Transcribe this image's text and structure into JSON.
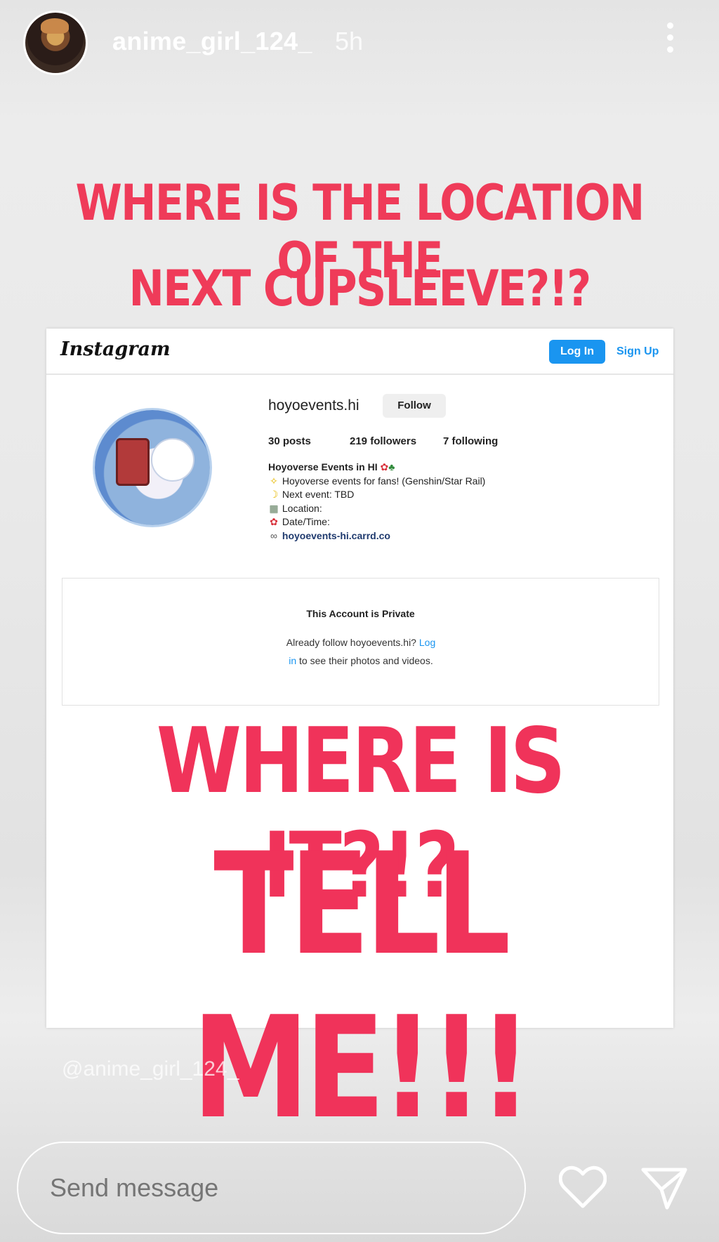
{
  "story": {
    "username": "anime_girl_124_",
    "time": "5h",
    "headline_line1": "WHERE IS THE LOCATION OF THE",
    "headline_line2": "NEXT CUPSLEEVE?!?",
    "big_line1": "WHERE IS IT?!?",
    "big_line2": "TELL ME!!!",
    "watermark": "@anime_girl_124_",
    "message_placeholder": "Send message",
    "accent_color": "#ef3b59"
  },
  "instagram_card": {
    "logo": "Instagram",
    "login_label": "Log In",
    "signup_label": "Sign Up",
    "handle": "hoyoevents.hi",
    "follow_label": "Follow",
    "posts": "30 posts",
    "followers": "219 followers",
    "following": "7 following",
    "bio_title": "Hoyoverse Events in HI",
    "bio_lines": [
      "Hoyoverse events for fans! (Genshin/Star Rail)",
      "Next event: TBD",
      "Location:",
      "Date/Time:"
    ],
    "bio_link": "hoyoevents-hi.carrd.co",
    "private_title": "This Account is Private",
    "private_text_1": "Already follow hoyoevents.hi?",
    "private_link_1": "Log",
    "private_link_2": "in",
    "private_text_2": "to see their photos and videos.",
    "link_color": "#1a95f0"
  }
}
